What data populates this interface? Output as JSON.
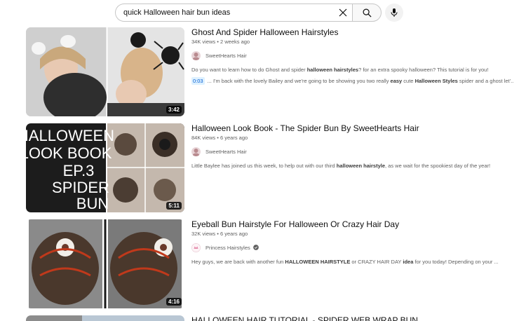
{
  "search": {
    "query": "quick Halloween hair bun ideas"
  },
  "icons": {
    "clear": "close-icon",
    "search": "search-icon",
    "mic": "microphone-icon",
    "verified": "check-circle-icon"
  },
  "results": [
    {
      "title": "Ghost And Spider Halloween Hairstyles",
      "views": "34K views",
      "age": "2 weeks ago",
      "channel": "SweetHearts Hair",
      "duration": "3:42",
      "desc": {
        "p1": "Do you want to learn how to do Ghost and spider ",
        "b1": "halloween hairstyles",
        "p2": "? for an extra spooky halloween? This tutorial is for you!"
      },
      "snippet": {
        "time": "0:03",
        "p1": "... I'm back with the lovely Bailey and we're going to be showing you two really ",
        "b1": "easy",
        "p2": " cute ",
        "b2": "Halloween Styles",
        "p3": " spider and a ghost let'..."
      }
    },
    {
      "title": "Halloween Look Book - The Spider Bun By SweetHearts Hair",
      "views": "84K views",
      "age": "6 years ago",
      "channel": "SweetHearts Hair",
      "duration": "5:11",
      "thumb_lines": [
        "HALLOWEEN",
        "LOOK BOOK",
        "EP.3",
        "SPIDER",
        "BUN"
      ],
      "desc": {
        "p1": "Little Baylee has joined us this week, to help out with our third ",
        "b1": "halloween hairstyle",
        "p2": ", as we wait for the spookiest day of the year!"
      }
    },
    {
      "title": "Eyeball Bun Hairstyle For Halloween Or Crazy Hair Day",
      "views": "32K views",
      "age": "6 years ago",
      "channel": "Princess Hairstyles",
      "duration": "4:16",
      "desc": {
        "p1": "Hey guys, we are back with another fun ",
        "b1": "HALLOWEEN HAIRSTYLE",
        "p2": " or CRAZY HAIR DAY ",
        "b2": "idea",
        "p3": " for you today! Depending on your ..."
      }
    },
    {
      "title": "HALLOWEEN HAIR TUTORIAL - SPIDER WEB WRAP BUN"
    }
  ]
}
